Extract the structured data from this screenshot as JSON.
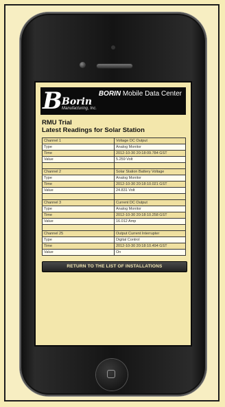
{
  "header": {
    "logo_letter": "B",
    "logo_name": "Borin",
    "logo_sub": "Manufacturing, Inc.",
    "brand": "BORIN",
    "title_rest": " Mobile Data Center"
  },
  "page": {
    "line1": "RMU Trial",
    "line2": "Latest Readings for Solar Station"
  },
  "channels": [
    {
      "channel_label": "Channel 1",
      "channel_value": "Voltage DC Output",
      "type_label": "Type",
      "type_value": "Analog Monitor",
      "time_label": "Time",
      "time_value": "2012-10-30 20:18:09.784 GST",
      "value_label": "Value",
      "value_value": "5.259 Volt"
    },
    {
      "channel_label": "Channel 2",
      "channel_value": "Solar Station Battery Voltage",
      "type_label": "Type",
      "type_value": "Analog Monitor",
      "time_label": "Time",
      "time_value": "2012-10-30 20:18:10.021 GST",
      "value_label": "Value",
      "value_value": "24.831 Volt"
    },
    {
      "channel_label": "Channel 3",
      "channel_value": "Current DC Output",
      "type_label": "Type",
      "type_value": "Analog Monitor",
      "time_label": "Time",
      "time_value": "2012-10-30 20:18:10.258 GST",
      "value_label": "Value",
      "value_value": "16.012 Amp"
    },
    {
      "channel_label": "Channel 25",
      "channel_value": "Output Current Interrupter",
      "type_label": "Type",
      "type_value": "Digital Control",
      "time_label": "Time",
      "time_value": "2012-10-30 20:18:10.494 GST",
      "value_label": "Value",
      "value_value": "On"
    }
  ],
  "buttons": {
    "return_label": "RETURN TO THE LIST OF INSTALLATIONS"
  },
  "icons": {
    "home": "home-button-icon",
    "camera": "front-camera-icon",
    "speaker": "earpiece-speaker-icon"
  }
}
